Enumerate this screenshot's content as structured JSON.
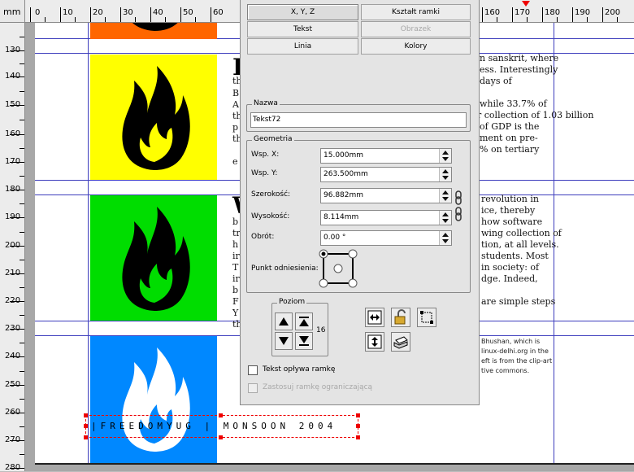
{
  "ruler": {
    "unit": "mm",
    "top_labels": [
      "0",
      "10",
      "20",
      "30",
      "40",
      "50",
      "60",
      "160",
      "170",
      "180",
      "190",
      "200"
    ],
    "left_labels": [
      "130",
      "140",
      "150",
      "160",
      "170",
      "180",
      "190",
      "200",
      "210",
      "220",
      "230",
      "240",
      "250",
      "260",
      "270",
      "280"
    ]
  },
  "document": {
    "col1_lines": [
      "n sanskrit, where",
      "ess. Interestingly",
      "days of",
      "while 33.7% of",
      "ther collection of 1.03 billion",
      "of GDP is the",
      "ment on pre-",
      "% on tertiary"
    ],
    "col1_lead": [
      "th",
      "B",
      "A",
      "th",
      "p",
      "th",
      "e"
    ],
    "col2_lines": [
      "revolution in",
      "ice, thereby",
      "how software",
      "wing collection of",
      "tion, at all levels.",
      "students. Most",
      "in society: of",
      "dge. Indeed,",
      "are simple steps"
    ],
    "col2_lead": [
      "b",
      "tr",
      "h",
      "ir",
      "T",
      "ir",
      "b",
      "F",
      "Y",
      "th"
    ],
    "drop_cap1": "I",
    "drop_cap2": "W",
    "caption_lines": [
      "Bhushan, which is",
      "linux-delhi.org in the",
      "eft is from the clip-art",
      "tive commons."
    ],
    "footer_text": "|FREEDOMYUG | MONSOON 2004",
    "colors": {
      "orange": "#ff6600",
      "yellow": "#ffff00",
      "green": "#00dd00",
      "blue": "#0088ff",
      "guide": "#3d3dbd"
    }
  },
  "palette": {
    "tabs": {
      "xyz": "X, Y, Z",
      "shape": "Kształt ramki",
      "text": "Tekst",
      "image": "Obrazek",
      "line": "Linia",
      "colors": "Kolory"
    },
    "name_group": {
      "title": "Nazwa",
      "value": "Tekst72"
    },
    "geometry": {
      "title": "Geometria",
      "x_label": "Wsp. X:",
      "x_value": "15.000mm",
      "y_label": "Wsp. Y:",
      "y_value": "263.500mm",
      "width_label": "Szerokość:",
      "width_value": "96.882mm",
      "height_label": "Wysokość:",
      "height_value": "8.114mm",
      "rotation_label": "Obrót:",
      "rotation_value": "0.00 °",
      "basepoint_label": "Punkt odniesienia:"
    },
    "level": {
      "title": "Poziom",
      "value": "16"
    },
    "text_flow_label": "Tekst opływa ramkę",
    "bounding_box_label": "Zastosuj ramkę ograniczającą"
  }
}
